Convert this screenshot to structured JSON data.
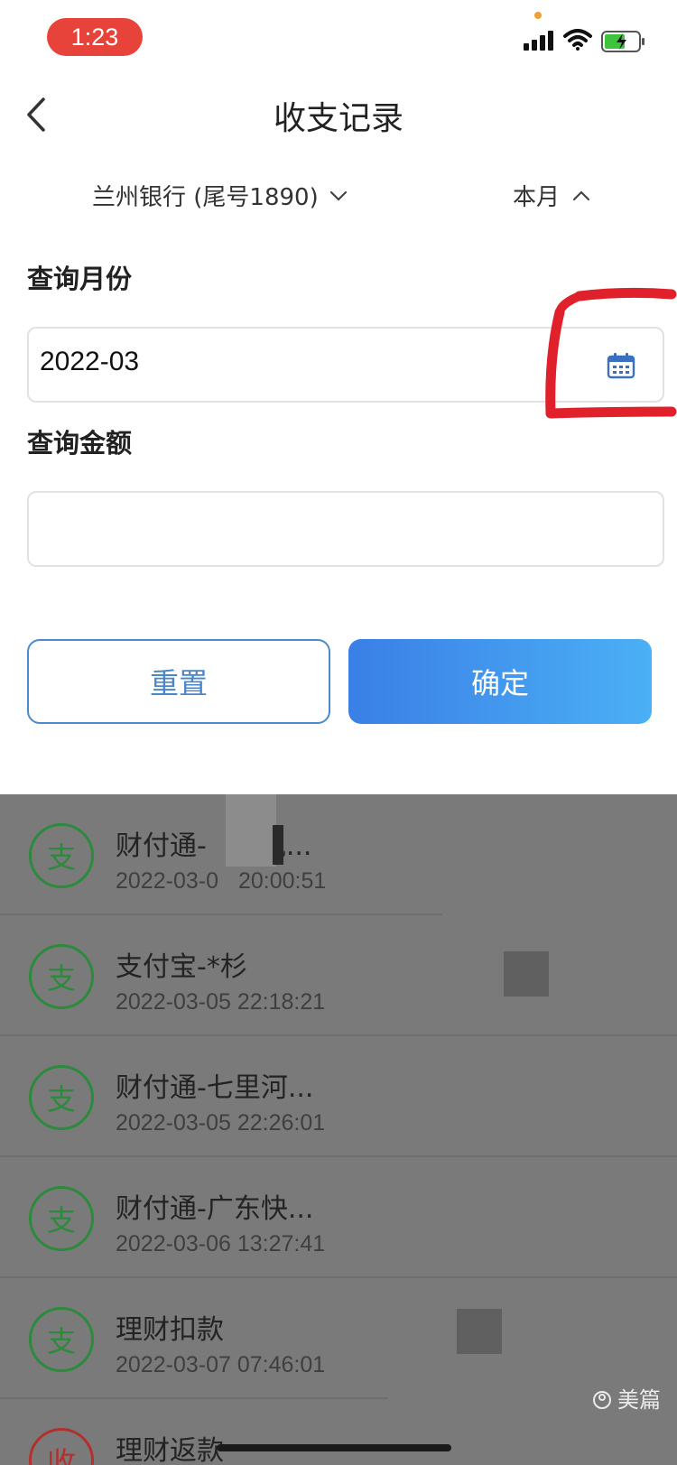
{
  "status_bar": {
    "time": "1:23"
  },
  "nav": {
    "title": "收支记录"
  },
  "filters": {
    "bank": "兰州银行 (尾号1890)",
    "period": "本月"
  },
  "form": {
    "month_label": "查询月份",
    "month_value": "2022-03",
    "amount_label": "查询金额",
    "amount_value": ""
  },
  "buttons": {
    "reset": "重置",
    "confirm": "确定"
  },
  "transactions": [
    {
      "type": "支",
      "title": "财付通-",
      "title_suffix": "凤...",
      "time": "2022-03-0",
      "time_suffix": "20:00:51"
    },
    {
      "type": "支",
      "title": "支付宝-*杉",
      "time": "2022-03-05 22:18:21"
    },
    {
      "type": "支",
      "title": "财付通-七里河...",
      "time": "2022-03-05 22:26:01"
    },
    {
      "type": "支",
      "title": "财付通-广东快...",
      "time": "2022-03-06 13:27:41"
    },
    {
      "type": "支",
      "title": "理财扣款",
      "time": "2022-03-07 07:46:01"
    },
    {
      "type": "收",
      "title": "理财返款",
      "time": ""
    }
  ],
  "watermark": {
    "brand": "美篇"
  },
  "colors": {
    "expense": "#2c8a3c",
    "income": "#b2302e",
    "accent": "#3a7fe6",
    "annotation": "#e0202a"
  }
}
